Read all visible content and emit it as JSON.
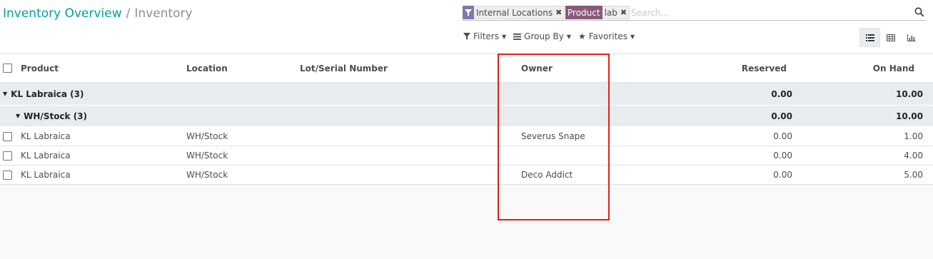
{
  "breadcrumb": {
    "parent": "Inventory Overview",
    "separator": "/",
    "current": "Inventory"
  },
  "search": {
    "facets": [
      {
        "icon": "filter-icon",
        "category": "",
        "value": "Internal Locations"
      },
      {
        "icon": "",
        "category": "Product",
        "value": "lab"
      }
    ],
    "placeholder": "Search..."
  },
  "toolbar": {
    "filters_label": "Filters",
    "groupby_label": "Group By",
    "favorites_label": "Favorites",
    "views": [
      "list-view-icon",
      "pivot-view-icon",
      "graph-view-icon"
    ],
    "active_view": "list"
  },
  "table": {
    "columns": {
      "product": "Product",
      "location": "Location",
      "lot": "Lot/Serial Number",
      "owner": "Owner",
      "reserved": "Reserved",
      "on_hand": "On Hand"
    },
    "group": {
      "label": "KL Labraica (3)",
      "reserved": "0.00",
      "on_hand": "10.00",
      "subgroup": {
        "label": "WH/Stock (3)",
        "reserved": "0.00",
        "on_hand": "10.00"
      }
    },
    "rows": [
      {
        "product": "KL Labraica",
        "location": "WH/Stock",
        "lot": "",
        "owner": "Severus Snape",
        "reserved": "0.00",
        "on_hand": "1.00"
      },
      {
        "product": "KL Labraica",
        "location": "WH/Stock",
        "lot": "",
        "owner": "",
        "reserved": "0.00",
        "on_hand": "4.00"
      },
      {
        "product": "KL Labraica",
        "location": "WH/Stock",
        "lot": "",
        "owner": "Deco Addict",
        "reserved": "0.00",
        "on_hand": "5.00"
      }
    ]
  },
  "colors": {
    "accent": "#00a09d",
    "facet_category": "#875a7b",
    "facet_filter": "#7c7bad",
    "highlight_box": "#e2201b"
  }
}
